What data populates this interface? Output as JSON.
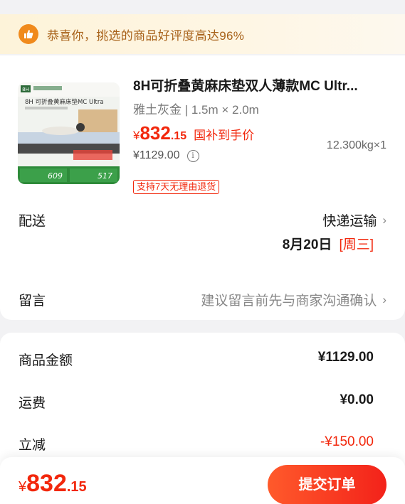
{
  "banner": {
    "text": "恭喜你，挑选的商品好评度高达96%",
    "icon": "thumbs-up-icon"
  },
  "product": {
    "title": "8H可折叠黄麻床垫双人薄款MC Ultr...",
    "spec": "雅土灰金 | 1.5m × 2.0m",
    "price_symbol": "¥",
    "price_int": "832",
    "price_dec": ".15",
    "price_tag": "国补到手价",
    "original_price": "¥1129.00",
    "weight_qty": "12.300kg×1",
    "return_policy": "支持7天无理由退货",
    "thumbnail": {
      "brand": "8H",
      "badge_text": "8H 可折叠黄麻床垫MC Ultra",
      "old_price": "609",
      "new_price": "517"
    }
  },
  "delivery": {
    "label": "配送",
    "method": "快递运输",
    "date": "8月20日",
    "weekday": "[周三]"
  },
  "message": {
    "label": "留言",
    "placeholder": "建议留言前先与商家沟通确认"
  },
  "summary": {
    "items": [
      {
        "label": "商品金额",
        "value": "¥1129.00"
      },
      {
        "label": "运费",
        "value": "¥0.00"
      },
      {
        "label": "立减",
        "value": "-¥150.00"
      }
    ]
  },
  "footer": {
    "total_symbol": "¥",
    "total_int": "832",
    "total_dec": ".15",
    "submit_label": "提交订单"
  },
  "colors": {
    "accent": "#f2270c",
    "banner_bg": "#fdf3d9",
    "banner_text": "#a8621a"
  }
}
